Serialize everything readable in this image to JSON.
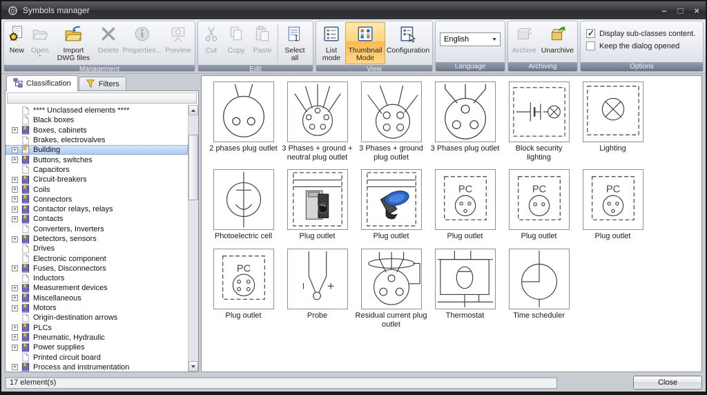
{
  "window": {
    "title": "Symbols manager"
  },
  "icons": {
    "minimize": "–",
    "maximize": "□",
    "close": "×"
  },
  "ribbon": {
    "management": {
      "caption": "Management",
      "new": "New",
      "open": "Open",
      "import_dwg": "Import DWG files",
      "delete": "Delete",
      "properties": "Properties...",
      "preview": "Preview"
    },
    "edit": {
      "caption": "Edit",
      "cut": "Cut",
      "copy": "Copy",
      "paste": "Paste",
      "select_all": "Select all"
    },
    "view": {
      "caption": "View",
      "list_mode": "List mode",
      "thumbnail_mode": "Thumbnail Mode",
      "configuration": "Configuration"
    },
    "language": {
      "caption": "Language",
      "selected": "English"
    },
    "archiving": {
      "caption": "Archiving",
      "archive": "Archive",
      "unarchive": "Unarchive"
    },
    "options": {
      "caption": "Options",
      "display_subclasses_label": "Display sub-classes content.",
      "display_subclasses_checked": true,
      "keep_dialog_label": "Keep the dialog opened",
      "keep_dialog_checked": false
    }
  },
  "sidebar": {
    "tabs": [
      {
        "label": "Classification",
        "active": true
      },
      {
        "label": "Filters",
        "active": false
      }
    ],
    "tree": [
      {
        "label": "**** Unclassed elements ****",
        "icon": "doc",
        "expandable": false,
        "selected": false
      },
      {
        "label": "Black boxes",
        "icon": "doc",
        "expandable": false,
        "selected": false
      },
      {
        "label": "Boxes, cabinets",
        "icon": "book",
        "expandable": true,
        "selected": false
      },
      {
        "label": "Brakes, electrovalves",
        "icon": "doc",
        "expandable": false,
        "selected": false
      },
      {
        "label": "Building",
        "icon": "book-open",
        "expandable": true,
        "selected": true
      },
      {
        "label": "Buttons, switches",
        "icon": "book",
        "expandable": true,
        "selected": false
      },
      {
        "label": "Capacitors",
        "icon": "doc",
        "expandable": false,
        "selected": false
      },
      {
        "label": "Circuit-breakers",
        "icon": "book",
        "expandable": true,
        "selected": false
      },
      {
        "label": "Coils",
        "icon": "book",
        "expandable": true,
        "selected": false
      },
      {
        "label": "Connectors",
        "icon": "book",
        "expandable": true,
        "selected": false
      },
      {
        "label": "Contactor relays, relays",
        "icon": "book",
        "expandable": true,
        "selected": false
      },
      {
        "label": "Contacts",
        "icon": "book",
        "expandable": true,
        "selected": false
      },
      {
        "label": "Converters, Inverters",
        "icon": "doc",
        "expandable": false,
        "selected": false
      },
      {
        "label": "Detectors, sensors",
        "icon": "book",
        "expandable": true,
        "selected": false
      },
      {
        "label": "Drives",
        "icon": "doc",
        "expandable": false,
        "selected": false
      },
      {
        "label": "Electronic component",
        "icon": "doc",
        "expandable": false,
        "selected": false
      },
      {
        "label": "Fuses, Disconnectors",
        "icon": "book",
        "expandable": true,
        "selected": false
      },
      {
        "label": "Inductors",
        "icon": "doc",
        "expandable": false,
        "selected": false
      },
      {
        "label": "Measurement devices",
        "icon": "book",
        "expandable": true,
        "selected": false
      },
      {
        "label": "Miscellaneous",
        "icon": "book",
        "expandable": true,
        "selected": false
      },
      {
        "label": "Motors",
        "icon": "book",
        "expandable": true,
        "selected": false
      },
      {
        "label": "Origin-destination arrows",
        "icon": "doc",
        "expandable": false,
        "selected": false
      },
      {
        "label": "PLCs",
        "icon": "book",
        "expandable": true,
        "selected": false
      },
      {
        "label": "Pneumatic, Hydraulic",
        "icon": "book",
        "expandable": true,
        "selected": false
      },
      {
        "label": "Power supplies",
        "icon": "book",
        "expandable": true,
        "selected": false
      },
      {
        "label": "Printed circuit board",
        "icon": "doc",
        "expandable": false,
        "selected": false
      },
      {
        "label": "Process and instrumentation",
        "icon": "book",
        "expandable": true,
        "selected": false
      }
    ]
  },
  "thumbnails": [
    {
      "label": "2 phases plug outlet",
      "symbol": "two_phase"
    },
    {
      "label": "3 Phases + ground + neutral plug outlet",
      "symbol": "five_pin"
    },
    {
      "label": "3 Phases + ground plug outlet",
      "symbol": "four_pin"
    },
    {
      "label": "3 Phases plug outlet",
      "symbol": "three_pin"
    },
    {
      "label": "Block security lighting",
      "symbol": "block_security"
    },
    {
      "label": "Lighting",
      "symbol": "lighting"
    },
    {
      "label": "Photoelectric cell",
      "symbol": "photoelectric"
    },
    {
      "label": "Plug outlet",
      "symbol": "plug_din"
    },
    {
      "label": "Plug outlet",
      "symbol": "plug_blue"
    },
    {
      "label": "Plug outlet",
      "symbol": "pc_3pin"
    },
    {
      "label": "Plug outlet",
      "symbol": "pc_2pin"
    },
    {
      "label": "Plug outlet",
      "symbol": "pc_3pin"
    },
    {
      "label": "Plug outlet",
      "symbol": "pc_4pin"
    },
    {
      "label": "Probe",
      "symbol": "probe"
    },
    {
      "label": "Residual current plug outlet",
      "symbol": "residual"
    },
    {
      "label": "Thermostat",
      "symbol": "thermostat"
    },
    {
      "label": "Time scheduler",
      "symbol": "time_scheduler"
    }
  ],
  "statusbar": {
    "count": "17 element(s)",
    "close_label": "Close"
  }
}
